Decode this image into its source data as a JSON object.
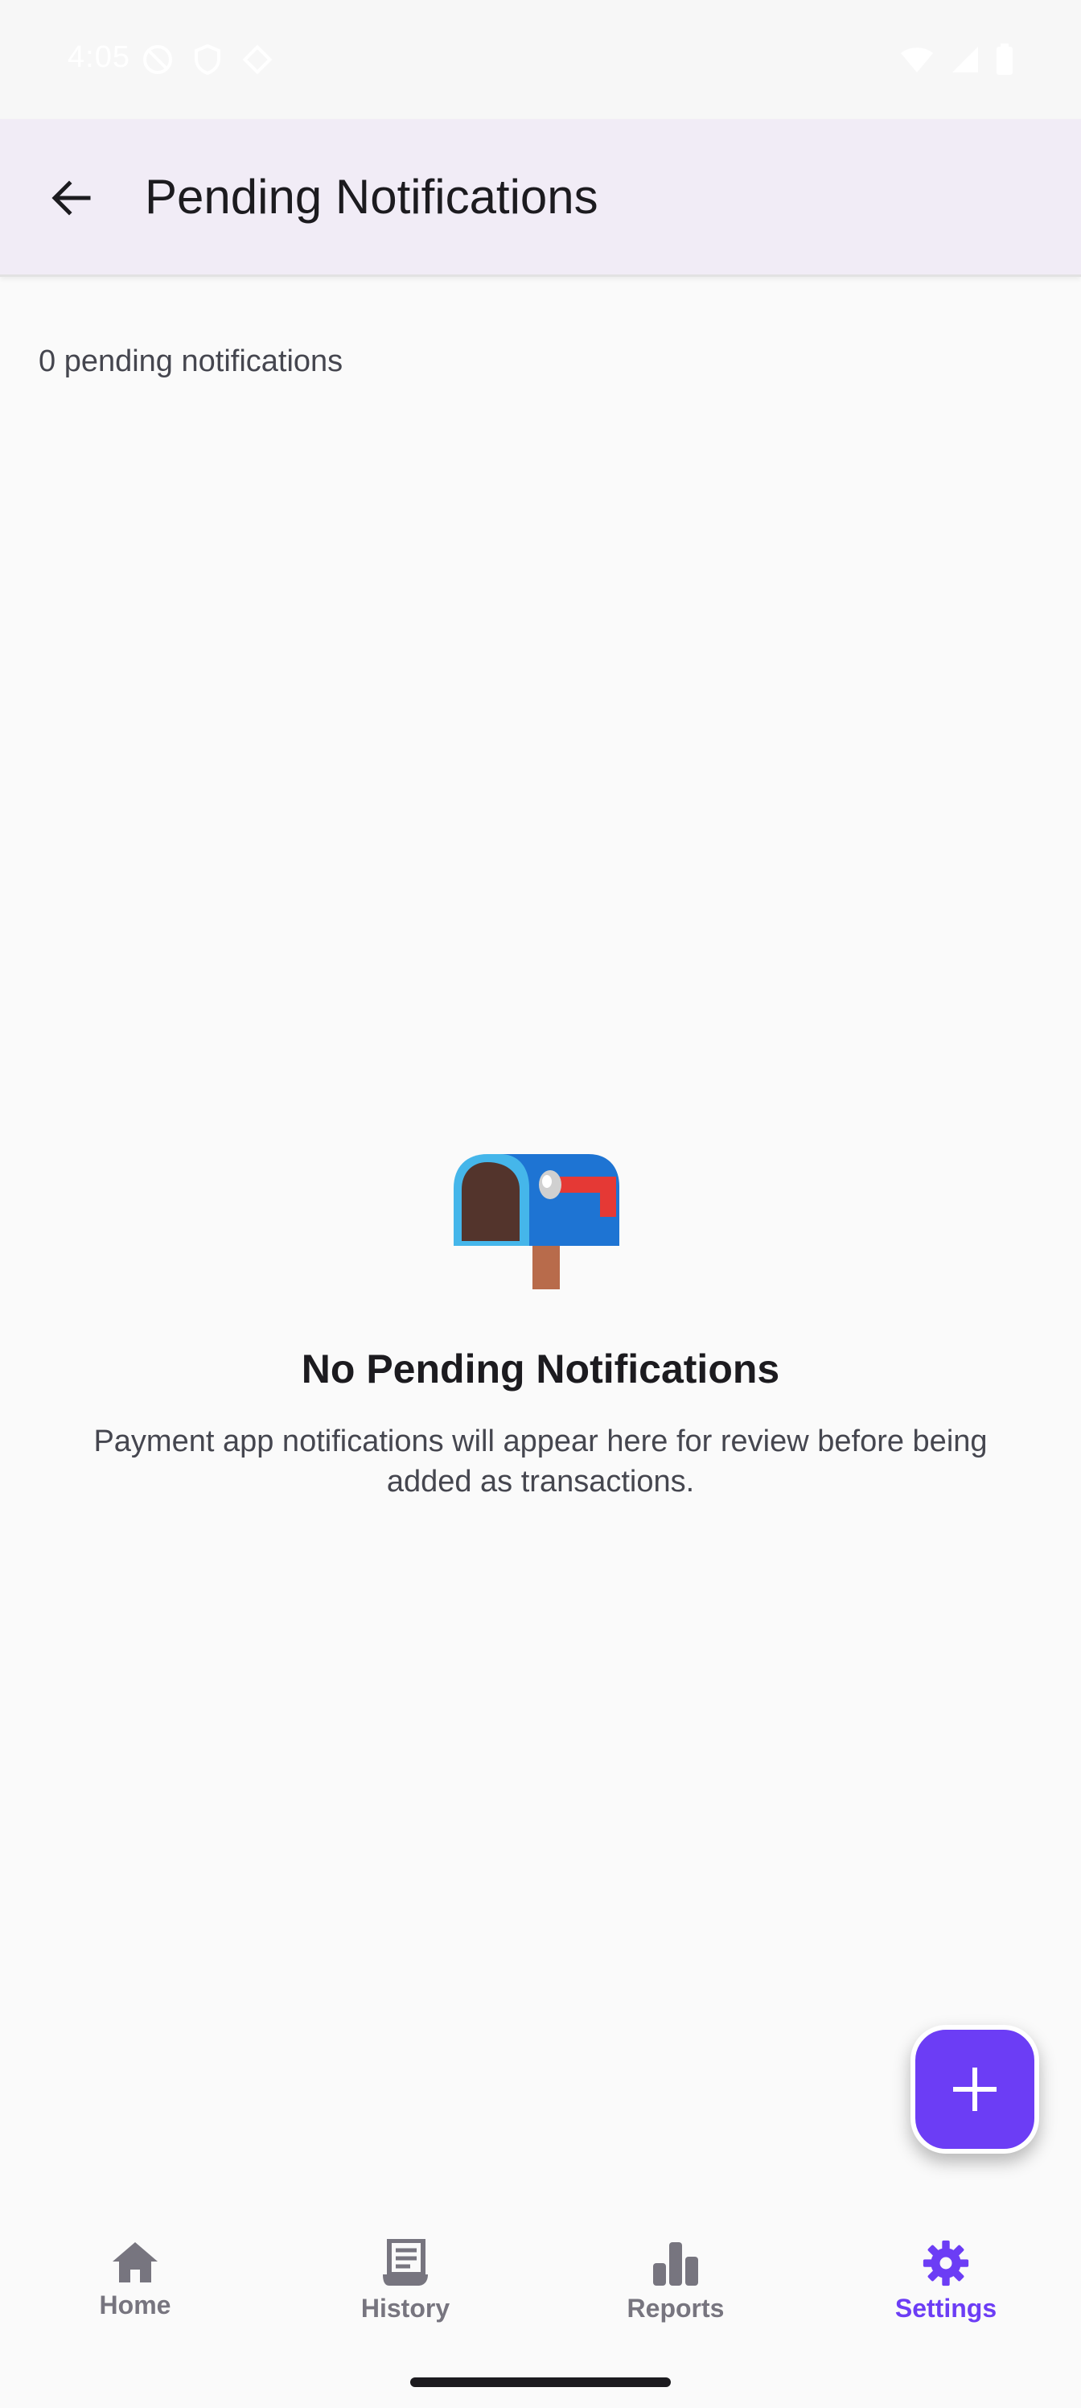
{
  "status_bar": {
    "time": "4:05",
    "icons_left": [
      "do-not-disturb-icon",
      "vpn-shield-icon",
      "location-diamond-icon"
    ],
    "icons_right": [
      "wifi-icon",
      "cellular-signal-icon",
      "battery-icon"
    ]
  },
  "app_bar": {
    "title": "Pending Notifications",
    "back_icon": "arrow-back-icon"
  },
  "content": {
    "pending_count_text": "0 pending notifications",
    "empty_state": {
      "icon": "mailbox-icon",
      "title": "No Pending Notifications",
      "description": "Payment app notifications will appear here for review before being added as transactions."
    }
  },
  "fab": {
    "icon": "plus-icon"
  },
  "bottom_nav": {
    "items": [
      {
        "label": "Home",
        "icon": "home-icon",
        "active": false
      },
      {
        "label": "History",
        "icon": "receipt-icon",
        "active": false
      },
      {
        "label": "Reports",
        "icon": "bar-chart-icon",
        "active": false
      },
      {
        "label": "Settings",
        "icon": "gear-icon",
        "active": true
      }
    ]
  },
  "colors": {
    "accent": "#6c3df5",
    "app_bar_bg": "#f1ecf6",
    "background": "#fafafa",
    "inactive_nav": "#77757f"
  }
}
